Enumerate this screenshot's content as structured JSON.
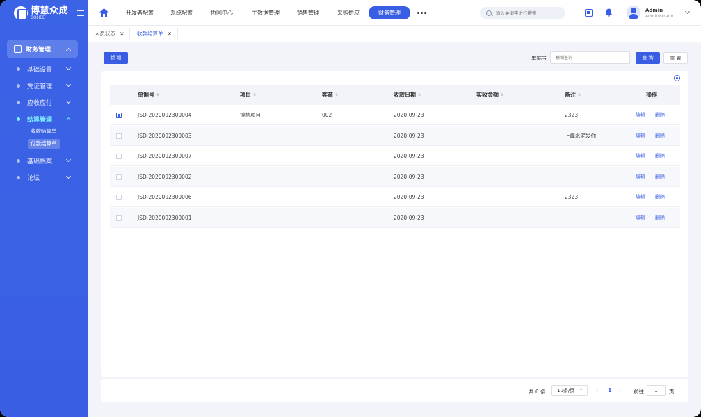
{
  "brand": {
    "name": "博慧众成",
    "en": "BOHEE"
  },
  "sidebar": {
    "active_menu": "财务管理",
    "items": [
      {
        "label": "基础设置",
        "expanded": false
      },
      {
        "label": "凭证管理",
        "expanded": false
      },
      {
        "label": "应收应付",
        "expanded": false
      },
      {
        "label": "结算管理",
        "expanded": true
      },
      {
        "label": "基础档案",
        "expanded": false
      },
      {
        "label": "论坛",
        "expanded": false
      }
    ],
    "leaves": [
      "收款结算单",
      "付款结算单"
    ]
  },
  "topnav": {
    "items": [
      "开发者配置",
      "系统配置",
      "协同中心",
      "主数据管理",
      "销售管理",
      "采购供应",
      "财务管理"
    ],
    "active": "财务管理",
    "search_placeholder": "输入关键字进行搜索",
    "user_name": "Admin",
    "user_role": "Administrator"
  },
  "tabs": [
    {
      "label": "人员状态",
      "close": "×"
    },
    {
      "label": "收款结算单",
      "close": "×"
    }
  ],
  "toolbar": {
    "add_label": "新 增",
    "filter_label": "单据号",
    "filter_placeholder": "模糊查询",
    "query_label": "查 询",
    "reset_label": "重 置"
  },
  "table": {
    "headers": [
      "单据号",
      "项目",
      "客商",
      "收款日期",
      "实收金额",
      "备注",
      "操作"
    ],
    "sort_icon": "⇅",
    "rows": [
      {
        "checked": true,
        "no": "JSD-2020092300004",
        "project": "博慧项目",
        "partner": "002",
        "date": "2020-09-23",
        "amount": "",
        "remark": "2323"
      },
      {
        "checked": false,
        "no": "JSD-2020092300003",
        "project": "",
        "partner": "",
        "date": "2020-09-23",
        "amount": "",
        "remark": "上峰水泥发你"
      },
      {
        "checked": false,
        "no": "JSD-2020092300007",
        "project": "",
        "partner": "",
        "date": "2020-09-23",
        "amount": "",
        "remark": ""
      },
      {
        "checked": false,
        "no": "JSD-2020092300002",
        "project": "",
        "partner": "",
        "date": "2020-09-23",
        "amount": "",
        "remark": ""
      },
      {
        "checked": false,
        "no": "JSD-2020092300006",
        "project": "",
        "partner": "",
        "date": "2020-09-23",
        "amount": "",
        "remark": "2323"
      },
      {
        "checked": false,
        "no": "JSD-2020092300001",
        "project": "",
        "partner": "",
        "date": "2020-09-23",
        "amount": "",
        "remark": ""
      }
    ],
    "edit_label": "编辑",
    "delete_label": "删除"
  },
  "pagination": {
    "total": "共 6 条",
    "page_size": "10条/页",
    "prev": "‹",
    "current": "1",
    "next": "›",
    "goto_label": "前往",
    "goto_value": "1",
    "page_suffix": "页"
  },
  "colors": {
    "primary": "#3a5ee3",
    "sidebar": "#3b63e6",
    "highlight": "#7ff0ff"
  }
}
